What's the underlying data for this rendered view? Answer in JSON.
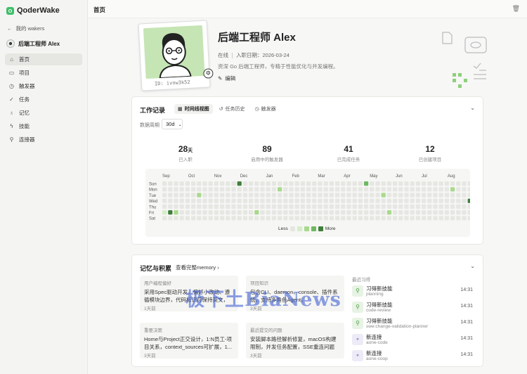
{
  "brand": {
    "name": "QoderWake"
  },
  "sidebar": {
    "back_label": "我的 wakers",
    "agent_name": "后端工程师 Alex",
    "items": [
      {
        "label": "首页",
        "icon": "home-icon",
        "active": true
      },
      {
        "label": "项目",
        "icon": "folder-icon"
      },
      {
        "label": "触发器",
        "icon": "clock-icon"
      },
      {
        "label": "任务",
        "icon": "check-circle-icon"
      },
      {
        "label": "记忆",
        "icon": "lightbulb-icon"
      },
      {
        "label": "技能",
        "icon": "lightning-icon"
      },
      {
        "label": "连接器",
        "icon": "plug-icon"
      }
    ]
  },
  "header": {
    "title": "首页"
  },
  "profile": {
    "name": "后端工程师 Alex",
    "status": "在线",
    "joined": "入职日期：2026-03-24",
    "bio": "资深 Go 后端工程师，专精于性能优化与并发编程。",
    "edit_label": "编辑",
    "id_label": "ID: ivnw3k52"
  },
  "work": {
    "title": "工作记录",
    "tabs": [
      "时间线视图",
      "任务历史",
      "触发器"
    ],
    "period_label": "数据周期",
    "period_value": "30d",
    "stats": [
      {
        "value": "28",
        "unit": "天",
        "label": "已入职"
      },
      {
        "value": "89",
        "unit": "",
        "label": "启用中的触发器"
      },
      {
        "value": "41",
        "unit": "",
        "label": "已完成任务"
      },
      {
        "value": "12",
        "unit": "",
        "label": "已创建项目"
      }
    ],
    "legend_less": "Less",
    "legend_more": "More",
    "colors": {
      "level0": "#e6e6e3",
      "level1": "#d6edc8",
      "level2": "#a8d98c",
      "level3": "#6fb862",
      "level4": "#3f7f3b"
    }
  },
  "chart_data": {
    "type": "heatmap",
    "x_labels": [
      "Sep",
      "Oct",
      "Nov",
      "Dec",
      "Jan",
      "Feb",
      "Mar",
      "Apr",
      "May",
      "Jun",
      "Jul",
      "Aug"
    ],
    "y_labels": [
      "Sun",
      "Mon",
      "Tue",
      "Wed",
      "Thu",
      "Fri",
      "Sat"
    ],
    "levels": [
      [
        0,
        0,
        0,
        0,
        0,
        0,
        0,
        0,
        0,
        0,
        0,
        0,
        0,
        4,
        0,
        0,
        0,
        0,
        0,
        0,
        0,
        0,
        0,
        0,
        0,
        0,
        0,
        0,
        0,
        0,
        0,
        0,
        0,
        0,
        0,
        3,
        0,
        0,
        0,
        0,
        0,
        0,
        0,
        0,
        0,
        0,
        0,
        0,
        0,
        0,
        0,
        0,
        0,
        0
      ],
      [
        0,
        0,
        0,
        0,
        0,
        0,
        0,
        0,
        0,
        0,
        0,
        0,
        0,
        0,
        0,
        0,
        0,
        0,
        0,
        0,
        2,
        0,
        0,
        0,
        0,
        0,
        0,
        0,
        0,
        0,
        0,
        0,
        0,
        0,
        0,
        0,
        0,
        0,
        0,
        0,
        0,
        0,
        0,
        0,
        0,
        0,
        0,
        0,
        0,
        0,
        2,
        0,
        0,
        0
      ],
      [
        0,
        0,
        0,
        0,
        0,
        0,
        2,
        0,
        0,
        0,
        0,
        0,
        0,
        0,
        0,
        0,
        0,
        0,
        0,
        0,
        0,
        0,
        0,
        0,
        0,
        0,
        0,
        0,
        0,
        0,
        0,
        0,
        0,
        0,
        0,
        0,
        0,
        0,
        2,
        0,
        0,
        0,
        0,
        0,
        0,
        0,
        0,
        0,
        0,
        0,
        0,
        0,
        0,
        0
      ],
      [
        0,
        0,
        0,
        0,
        0,
        0,
        0,
        0,
        0,
        0,
        0,
        0,
        0,
        0,
        0,
        0,
        0,
        0,
        0,
        0,
        0,
        0,
        0,
        0,
        0,
        0,
        0,
        0,
        0,
        0,
        0,
        0,
        0,
        0,
        0,
        0,
        0,
        0,
        0,
        0,
        0,
        0,
        0,
        0,
        0,
        0,
        0,
        0,
        0,
        0,
        0,
        0,
        0,
        4
      ],
      [
        0,
        0,
        0,
        0,
        0,
        0,
        0,
        0,
        0,
        0,
        0,
        0,
        0,
        0,
        0,
        0,
        0,
        0,
        0,
        0,
        0,
        0,
        0,
        0,
        0,
        0,
        0,
        0,
        0,
        0,
        0,
        0,
        0,
        0,
        0,
        0,
        0,
        0,
        0,
        0,
        0,
        0,
        0,
        0,
        0,
        0,
        0,
        0,
        0,
        0,
        0,
        0,
        0,
        0
      ],
      [
        1,
        4,
        2,
        0,
        0,
        0,
        0,
        0,
        0,
        0,
        0,
        0,
        0,
        0,
        0,
        0,
        2,
        0,
        0,
        0,
        0,
        0,
        0,
        0,
        0,
        0,
        0,
        0,
        0,
        0,
        0,
        0,
        0,
        0,
        0,
        0,
        0,
        0,
        0,
        2,
        0,
        0,
        0,
        0,
        0,
        0,
        0,
        0,
        0,
        0,
        0,
        0,
        0,
        0
      ],
      [
        0,
        0,
        0,
        0,
        0,
        0,
        0,
        0,
        0,
        0,
        0,
        0,
        0,
        0,
        0,
        0,
        0,
        0,
        0,
        0,
        0,
        0,
        0,
        0,
        0,
        0,
        0,
        0,
        0,
        0,
        0,
        0,
        0,
        0,
        0,
        0,
        0,
        0,
        0,
        0,
        0,
        0,
        0,
        0,
        0,
        0,
        0,
        0,
        0,
        0,
        0,
        0,
        0,
        0
      ]
    ]
  },
  "memory": {
    "title": "记忆与积累",
    "see_all": "查看完整memory",
    "cards": [
      {
        "tag": "用户编程偏好",
        "text": "采用Spec驱动开发，偏好小改动、遵循模块边界，代码标识符保持英文，文...",
        "time": "1天前"
      },
      {
        "tag": "项目知识",
        "text": "包含CLI、daemon、console、插件系统，支持多角色Agent。",
        "time": "3天前"
      },
      {
        "tag": "重要决策",
        "text": "Home与Project正交设计，1:N员工-项目关系，context_sources可扩展，1...",
        "time": "3天前"
      },
      {
        "tag": "最近提交的问题",
        "text": "安装脚本路径解析修复，macOS构建限制，并发任务配置，SSE重连问题回...",
        "time": "3天前"
      }
    ],
    "recent_title": "最近习得",
    "recent": [
      {
        "name": "习得新技能",
        "sub": "planning",
        "time": "14:31",
        "kind": "skill"
      },
      {
        "name": "习得新技能",
        "sub": "code-review",
        "time": "14:31",
        "kind": "skill"
      },
      {
        "name": "习得新技能",
        "sub": "swe:change-validation-planner",
        "time": "14:31",
        "kind": "skill"
      },
      {
        "name": "新连接",
        "sub": "aone-code",
        "time": "14:31",
        "kind": "connector"
      },
      {
        "name": "新连接",
        "sub": "aone-coop",
        "time": "14:31",
        "kind": "connector"
      }
    ]
  },
  "watermark": "极下土BiaNews"
}
